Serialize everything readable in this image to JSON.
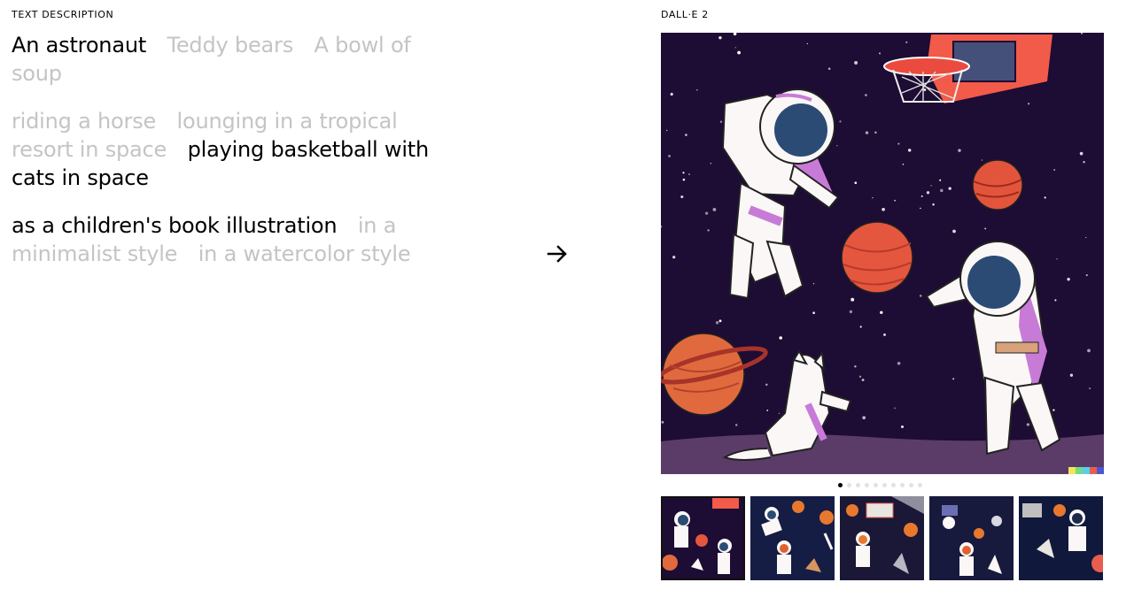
{
  "left_panel": {
    "label": "TEXT DESCRIPTION"
  },
  "right_panel": {
    "label": "DALL·E 2"
  },
  "prompt": {
    "subject": {
      "options": [
        "An astronaut",
        "Teddy bears",
        "A bowl of soup"
      ],
      "selected": 0
    },
    "action": {
      "options": [
        "riding a horse",
        "lounging in a tropical resort in space",
        "playing basketball with cats in space"
      ],
      "selected": 2
    },
    "style": {
      "options": [
        "as a children's book illustration",
        "in a minimalist style",
        "in a watercolor style"
      ],
      "selected": 0
    }
  },
  "icons": {
    "generate": "arrow-right-icon"
  },
  "carousel": {
    "count": 10,
    "active_index": 0
  },
  "thumbnails": {
    "count": 5,
    "active_index": 0,
    "descriptions": [
      "astronaut-cats-basketball-variant-1",
      "astronaut-cats-basketball-variant-2",
      "astronaut-cats-basketball-variant-3",
      "astronaut-cats-basketball-variant-4",
      "astronaut-cats-basketball-variant-5"
    ]
  },
  "colors": {
    "selected_text": "#000000",
    "unselected_text": "#c4c4c4",
    "active_dot": "#000000",
    "inactive_dot": "#e2e2e2"
  }
}
